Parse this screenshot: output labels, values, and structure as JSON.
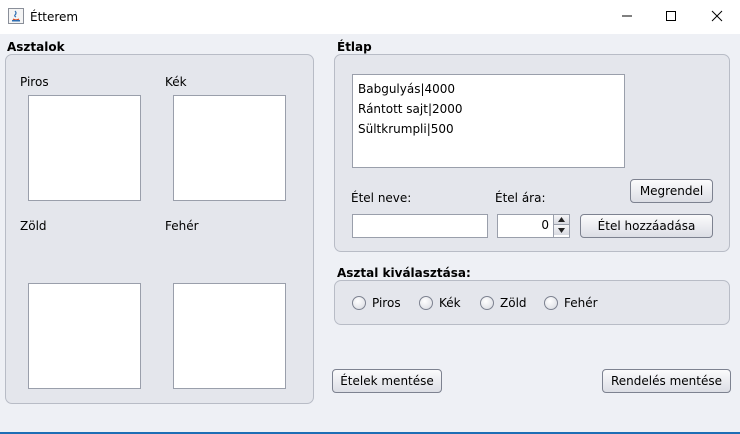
{
  "window": {
    "title": "Étterem"
  },
  "tables_panel": {
    "title": "Asztalok",
    "tables": [
      {
        "label": "Piros"
      },
      {
        "label": "Kék"
      },
      {
        "label": "Zöld"
      },
      {
        "label": "Fehér"
      }
    ]
  },
  "menu_panel": {
    "title": "Étlap",
    "items": [
      "Babgulyás|4000",
      "Rántott sajt|2000",
      "Sültkrumpli|500"
    ],
    "order_button": "Megrendel",
    "food_name_label": "Étel neve:",
    "food_name_value": "",
    "food_price_label": "Étel ára:",
    "food_price_value": "0",
    "add_food_button": "Étel hozzáadása"
  },
  "table_select_panel": {
    "title": "Asztal kiválasztása:",
    "options": [
      "Piros",
      "Kék",
      "Zöld",
      "Fehér"
    ]
  },
  "footer": {
    "save_foods_button": "Ételek mentése",
    "save_order_button": "Rendelés mentése"
  }
}
